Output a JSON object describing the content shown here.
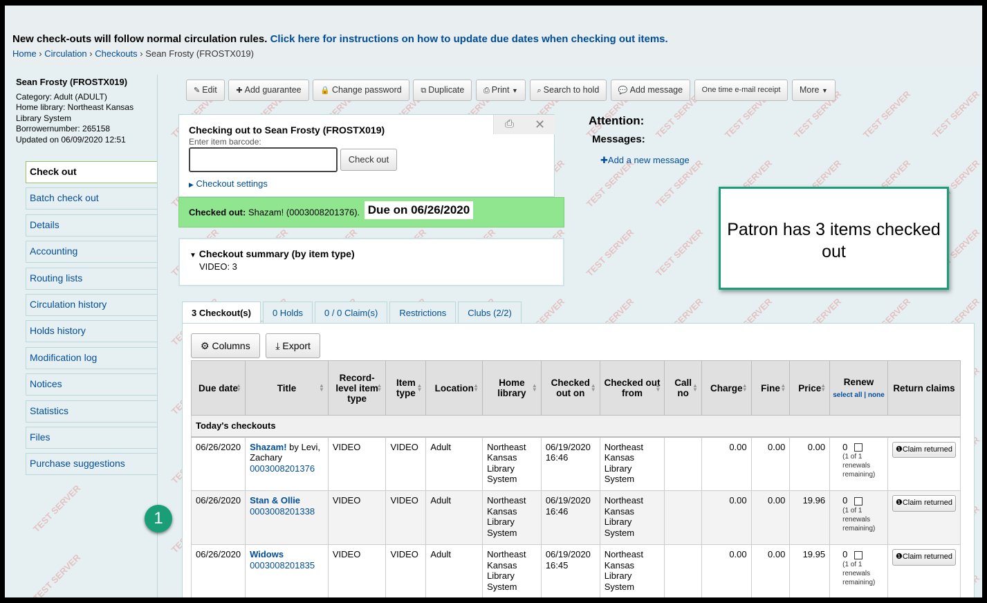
{
  "banner": {
    "notice_text": "New check-outs will follow normal circulation rules.",
    "notice_link": "Click here for instructions on how to update due dates when checking out items."
  },
  "breadcrumb": {
    "home": "Home",
    "circulation": "Circulation",
    "checkouts": "Checkouts",
    "current": "Sean Frosty (FROSTX019)"
  },
  "patron": {
    "name": "Sean Frosty (FROSTX019)",
    "category": "Category: Adult (ADULT)",
    "library": "Home library: Northeast Kansas Library System",
    "borrowernumber": "Borrowernumber: 265158",
    "updated": "Updated on 06/09/2020 12:51"
  },
  "sidebar": {
    "items": [
      "Check out",
      "Batch check out",
      "Details",
      "Accounting",
      "Routing lists",
      "Circulation history",
      "Holds history",
      "Modification log",
      "Notices",
      "Statistics",
      "Files",
      "Purchase suggestions"
    ]
  },
  "toolbar": {
    "edit": "Edit",
    "add_guarantee": "Add guarantee",
    "change_password": "Change password",
    "duplicate": "Duplicate",
    "print": "Print",
    "search_to_hold": "Search to hold",
    "add_message": "Add message",
    "email_receipt": "One time e-mail receipt",
    "more": "More"
  },
  "checkout": {
    "title": "Checking out to Sean Frosty (FROSTX019)",
    "barcode_label": "Enter item barcode:",
    "barcode_value": "",
    "button": "Check out",
    "settings": "Checkout settings",
    "checked_out_label": "Checked out:",
    "checked_out_item": "Shazam! (0003008201376).",
    "due": "Due on 06/26/2020"
  },
  "summary": {
    "heading": "Checkout summary (by item type)",
    "line": "VIDEO: 3"
  },
  "attention": {
    "title": "Attention:",
    "messages": "Messages:",
    "add_message": "Add a new message"
  },
  "callout": {
    "text": "Patron has 3 items checked out"
  },
  "step_badge": "1",
  "tabs": [
    "3 Checkout(s)",
    "0 Holds",
    "0 / 0 Claim(s)",
    "Restrictions",
    "Clubs (2/2)"
  ],
  "panel_buttons": {
    "columns": "Columns",
    "export": "Export"
  },
  "table": {
    "headers": [
      "Due date",
      "Title",
      "Record-level item type",
      "Item type",
      "Location",
      "Home library",
      "Checked out on",
      "Checked out from",
      "Call no",
      "Charge",
      "Fine",
      "Price",
      "Renew",
      "Return claims"
    ],
    "renew_select_all": "select all",
    "renew_none": "none",
    "group_label": "Today's checkouts",
    "rows": [
      {
        "due": "06/26/2020",
        "title": "Shazam!",
        "author": " by Levi, Zachary",
        "barcode": "0003008201376",
        "record_type": "VIDEO",
        "item_type": "VIDEO",
        "location": "Adult",
        "home_library": "Northeast Kansas Library System",
        "checked_out_on": "06/19/2020 16:46",
        "checked_out_from": "Northeast Kansas Library System",
        "call_no": "",
        "charge": "0.00",
        "fine": "0.00",
        "price": "0.00",
        "renew_count": "0",
        "renew_note": "(1 of 1 renewals remaining)",
        "claim": "Claim returned"
      },
      {
        "due": "06/26/2020",
        "title": "Stan & Ollie",
        "author": "",
        "barcode": "0003008201338",
        "record_type": "VIDEO",
        "item_type": "VIDEO",
        "location": "Adult",
        "home_library": "Northeast Kansas Library System",
        "checked_out_on": "06/19/2020 16:46",
        "checked_out_from": "Northeast Kansas Library System",
        "call_no": "",
        "charge": "0.00",
        "fine": "0.00",
        "price": "19.96",
        "renew_count": "0",
        "renew_note": "(1 of 1 renewals remaining)",
        "claim": "Claim returned"
      },
      {
        "due": "06/26/2020",
        "title": "Widows",
        "author": "",
        "barcode": "0003008201835",
        "record_type": "VIDEO",
        "item_type": "VIDEO",
        "location": "Adult",
        "home_library": "Northeast Kansas Library System",
        "checked_out_on": "06/19/2020 16:45",
        "checked_out_from": "Northeast Kansas Library System",
        "call_no": "",
        "charge": "0.00",
        "fine": "0.00",
        "price": "19.95",
        "renew_count": "0",
        "renew_note": "(1 of 1 renewals remaining)",
        "claim": "Claim returned"
      }
    ]
  },
  "watermark": "TEST SERVER",
  "colors": {
    "link": "#004d99",
    "success": "#90e68e",
    "accent": "#1a9e78",
    "background": "#e6f0f2"
  }
}
